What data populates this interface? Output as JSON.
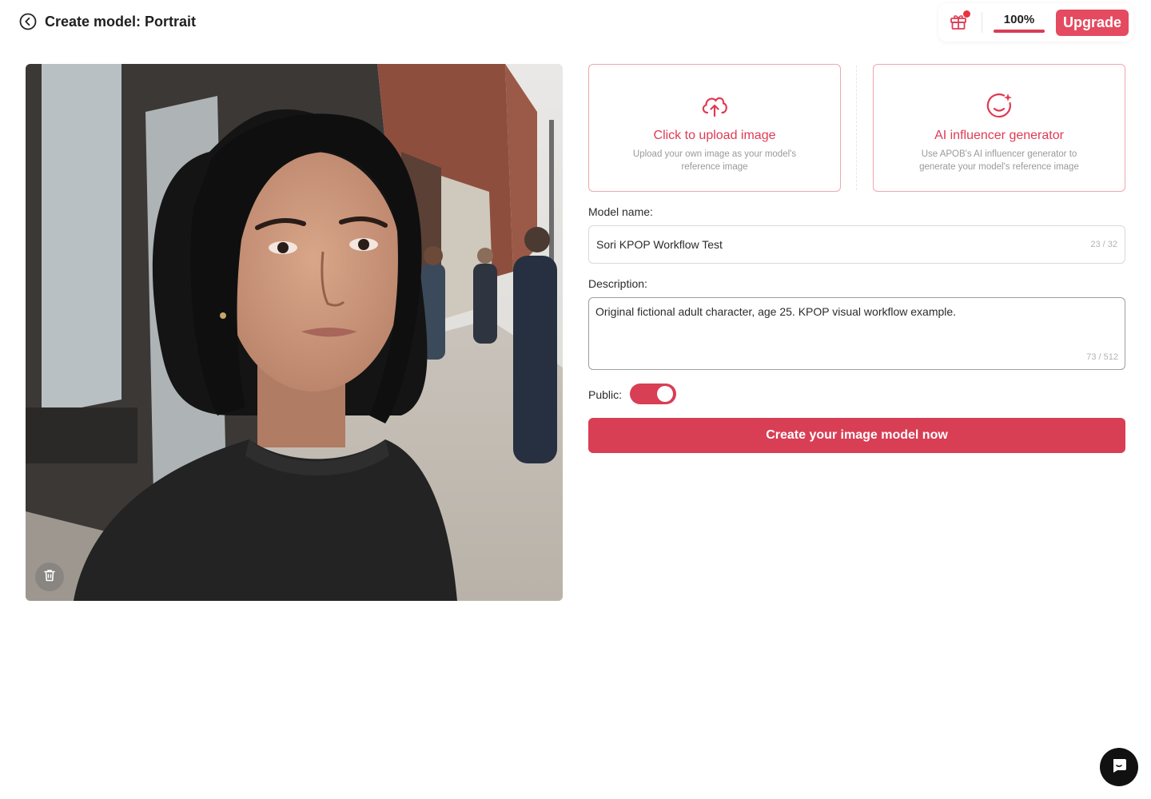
{
  "header": {
    "back_icon": "circle-chevron-left-icon",
    "title": "Create model: Portrait",
    "gift_icon": "gift-icon",
    "credit_percent": "100%",
    "credit_fraction": 1.0,
    "upgrade_label": "Upgrade"
  },
  "photo": {
    "description_icon": "reference-photo",
    "delete_icon": "trash-icon"
  },
  "upload_card": {
    "icon": "cloud-upload-icon",
    "title": "Click to upload image",
    "subtitle": "Upload your own image as your model's reference image"
  },
  "ai_card": {
    "icon": "sparkle-face-icon",
    "title": "AI influencer generator",
    "subtitle": "Use APOB's AI influencer generator to generate your model's reference image"
  },
  "form": {
    "name_label": "Model name:",
    "name_value": "Sori KPOP Workflow Test",
    "name_count": "23 / 32",
    "desc_label": "Description:",
    "desc_value": "Original fictional adult character, age 25. KPOP visual workflow example.",
    "desc_count": "73 / 512",
    "public_label": "Public:",
    "public_on": true,
    "submit_label": "Create your image model now"
  },
  "chat": {
    "icon": "chat-bubble-icon"
  },
  "colors": {
    "accent": "#d83e54",
    "accent_light": "#f0a6b1",
    "accent_text": "#e03a53"
  }
}
